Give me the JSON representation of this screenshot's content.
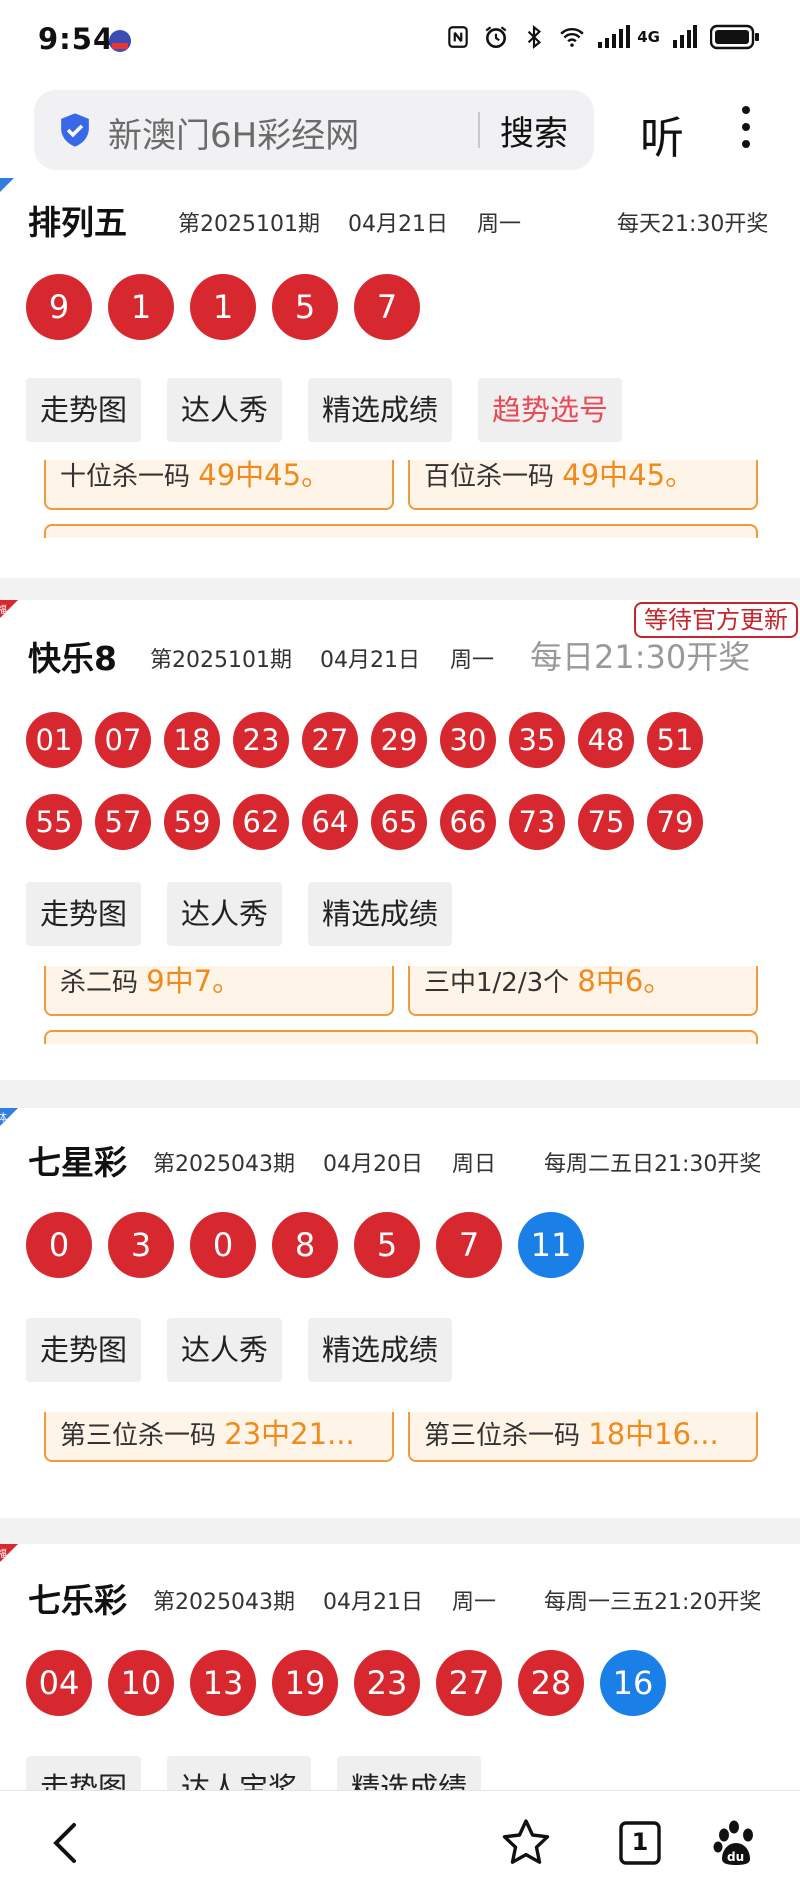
{
  "status_bar": {
    "time": "9:54",
    "network": "4G"
  },
  "search": {
    "query": "新澳门6H彩经网",
    "search_label": "搜索",
    "listen_label": "听"
  },
  "cards": [
    {
      "name": "排列五",
      "period": "第2025101期",
      "date": "04月21日",
      "weekday": "周一",
      "schedule": "每天21:30开奖",
      "balls": [
        "9",
        "1",
        "1",
        "5",
        "7"
      ],
      "actions": [
        "走势图",
        "达人秀",
        "精选成绩",
        "趋势选号"
      ],
      "stats": [
        {
          "label": "十位杀一码",
          "value": "49中45。"
        },
        {
          "label": "百位杀一码",
          "value": "49中45。"
        }
      ]
    },
    {
      "name": "快乐8",
      "period": "第2025101期",
      "date": "04月21日",
      "weekday": "周一",
      "schedule": "每日21:30开奖",
      "badge": "等待官方更新",
      "balls": [
        "01",
        "07",
        "18",
        "23",
        "27",
        "29",
        "30",
        "35",
        "48",
        "51",
        "55",
        "57",
        "59",
        "62",
        "64",
        "65",
        "66",
        "73",
        "75",
        "79"
      ],
      "actions": [
        "走势图",
        "达人秀",
        "精选成绩"
      ],
      "stats": [
        {
          "label": "杀二码",
          "value": "9中7。"
        },
        {
          "label": "三中1/2/3个",
          "value": "8中6。"
        }
      ]
    },
    {
      "name": "七星彩",
      "period": "第2025043期",
      "date": "04月20日",
      "weekday": "周日",
      "schedule": "每周二五日21:30开奖",
      "balls": [
        "0",
        "3",
        "0",
        "8",
        "5",
        "7"
      ],
      "blue_balls": [
        "11"
      ],
      "actions": [
        "走势图",
        "达人秀",
        "精选成绩"
      ],
      "stats": [
        {
          "label": "第三位杀一码",
          "value": "23中21..."
        },
        {
          "label": "第三位杀一码",
          "value": "18中16..."
        }
      ]
    },
    {
      "name": "七乐彩",
      "period": "第2025043期",
      "date": "04月21日",
      "weekday": "周一",
      "schedule": "每周一三五21:20开奖",
      "balls": [
        "04",
        "10",
        "13",
        "19",
        "23",
        "27",
        "28"
      ],
      "blue_balls": [
        "16"
      ],
      "actions": [
        "走势图",
        "达人宝奖",
        "精选成绩"
      ]
    }
  ],
  "bottom_nav": {
    "tab_count": "1"
  },
  "colors": {
    "red_ball": "#d7282f",
    "blue_ball": "#1b7fe8",
    "accent_orange": "#f08a1c",
    "badge_red": "#c5252c"
  }
}
